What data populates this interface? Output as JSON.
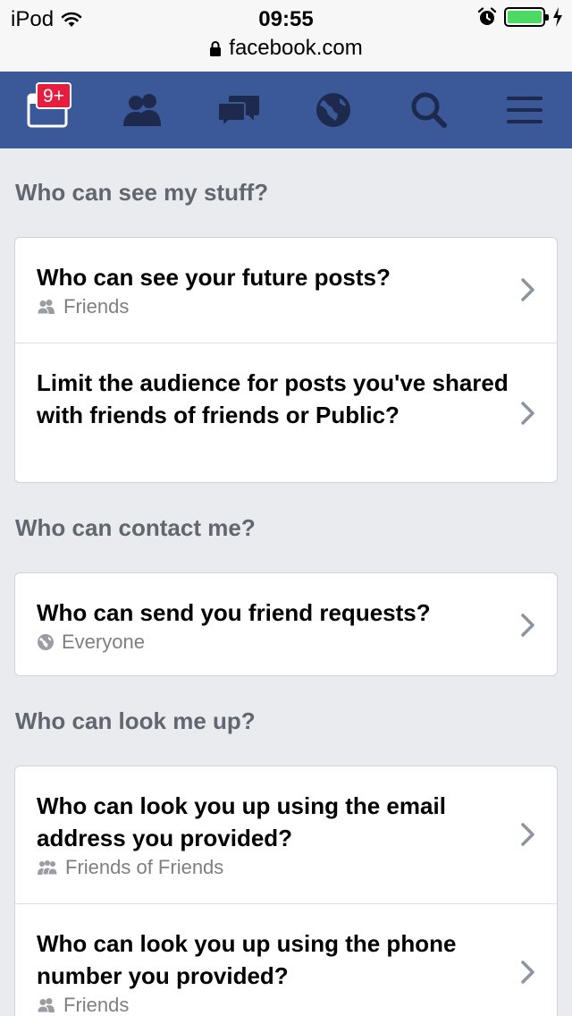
{
  "status_bar": {
    "carrier": "iPod",
    "time": "09:55",
    "url": "facebook.com",
    "battery_level": 1.0
  },
  "nav": {
    "notifications_badge": "9+",
    "items": [
      "home-icon",
      "friends-icon",
      "messages-icon",
      "globe-icon",
      "search-icon",
      "menu-icon"
    ]
  },
  "sections": [
    {
      "heading": "Who can see my stuff?",
      "rows": [
        {
          "title": "Who can see your future posts?",
          "subtitle": "Friends",
          "subtitle_icon": "friends-small-icon"
        },
        {
          "title": "Limit the audience for posts you've shared with friends of friends or Public?"
        }
      ]
    },
    {
      "heading": "Who can contact me?",
      "rows": [
        {
          "title": "Who can send you friend requests?",
          "subtitle": "Everyone",
          "subtitle_icon": "globe-small-icon"
        }
      ]
    },
    {
      "heading": "Who can look me up?",
      "rows": [
        {
          "title": "Who can look you up using the email address you provided?",
          "subtitle": "Friends of Friends",
          "subtitle_icon": "friends-of-friends-small-icon"
        },
        {
          "title": "Who can look you up using the phone number you provided?",
          "subtitle": "Friends",
          "subtitle_icon": "friends-small-icon"
        }
      ]
    }
  ],
  "colors": {
    "nav_bg": "#3b5998",
    "page_bg": "#e9ebee",
    "badge": "#e41e3f",
    "battery": "#4cd964"
  }
}
